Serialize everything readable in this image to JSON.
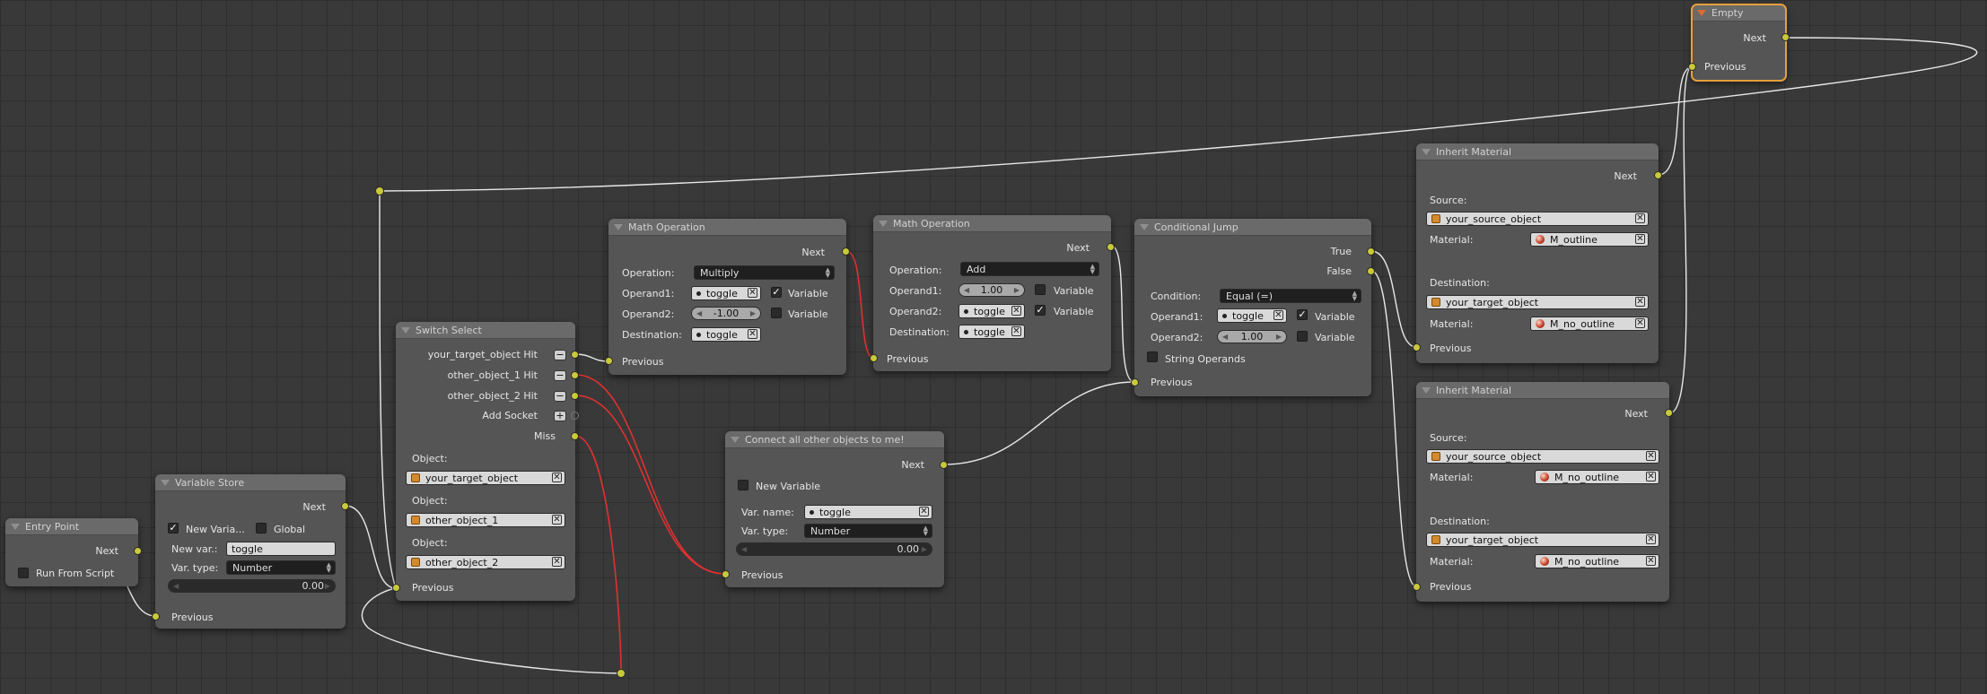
{
  "colors": {
    "socket": "#c9c93a",
    "link": "#e8e8e8",
    "miss_link": "#e03030",
    "selected_outline": "#e6a03c"
  },
  "entry": {
    "title": "Entry Point",
    "next": "Next",
    "run_from_script": "Run From Script"
  },
  "varstore": {
    "title": "Variable Store",
    "next": "Next",
    "new_var_chk": "New Varia...",
    "global": "Global",
    "new_var_label": "New var.:",
    "new_var_value": "toggle",
    "var_type_label": "Var. type:",
    "var_type_value": "Number",
    "value": "0.00",
    "previous": "Previous"
  },
  "switch": {
    "title": "Switch Select",
    "hit1": "your_target_object Hit",
    "hit2": "other_object_1 Hit",
    "hit3": "other_object_2 Hit",
    "add_socket": "Add Socket",
    "miss": "Miss",
    "object_label": "Object:",
    "obj1": "your_target_object",
    "obj2": "other_object_1",
    "obj3": "other_object_2",
    "previous": "Previous"
  },
  "math1": {
    "title": "Math Operation",
    "next": "Next",
    "operation_label": "Operation:",
    "operation": "Multiply",
    "op1_label": "Operand1:",
    "op1": "toggle",
    "variable": "Variable",
    "op2_label": "Operand2:",
    "op2": "-1.00",
    "dest_label": "Destination:",
    "dest": "toggle",
    "previous": "Previous"
  },
  "math2": {
    "title": "Math Operation",
    "next": "Next",
    "operation_label": "Operation:",
    "operation": "Add",
    "op1_label": "Operand1:",
    "op1": "1.00",
    "variable": "Variable",
    "op2_label": "Operand2:",
    "op2": "toggle",
    "dest_label": "Destination:",
    "dest": "toggle",
    "previous": "Previous"
  },
  "cond": {
    "title": "Conditional Jump",
    "true_l": "True",
    "false_l": "False",
    "condition_label": "Condition:",
    "condition": "Equal (=)",
    "op1_label": "Operand1:",
    "op1": "toggle",
    "variable": "Variable",
    "op2_label": "Operand2:",
    "op2": "1.00",
    "string_ops": "String Operands",
    "previous": "Previous"
  },
  "connect": {
    "title": "Connect all other objects to me!",
    "next": "Next",
    "new_variable": "New Variable",
    "var_name_label": "Var. name:",
    "var_name": "toggle",
    "var_type_label": "Var. type:",
    "var_type": "Number",
    "value": "0.00",
    "previous": "Previous"
  },
  "inherit1": {
    "title": "Inherit Material",
    "next": "Next",
    "source_label": "Source:",
    "source": "your_source_object",
    "material_label": "Material:",
    "mat1": "M_outline",
    "dest_label": "Destination:",
    "dest": "your_target_object",
    "mat2": "M_no_outline",
    "previous": "Previous"
  },
  "inherit2": {
    "title": "Inherit Material",
    "next": "Next",
    "source_label": "Source:",
    "source": "your_source_object",
    "material_label": "Material:",
    "mat1": "M_no_outline",
    "dest_label": "Destination:",
    "dest": "your_target_object",
    "mat2": "M_no_outline",
    "previous": "Previous"
  },
  "empty": {
    "title": "Empty",
    "next": "Next",
    "previous": "Previous"
  }
}
